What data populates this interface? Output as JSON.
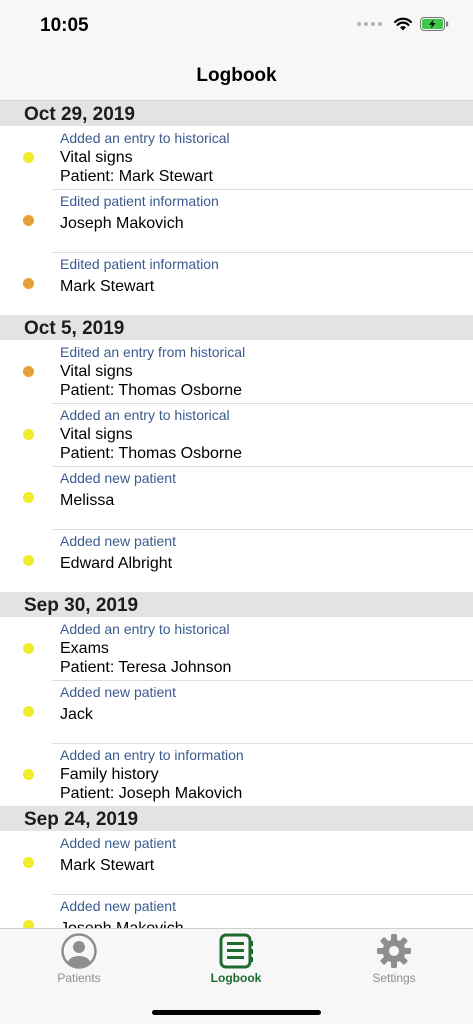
{
  "status_bar": {
    "time": "10:05"
  },
  "nav": {
    "title": "Logbook"
  },
  "colors": {
    "dot_added": "#f0ea2a",
    "dot_edited": "#e2a131",
    "active_tab": "#1f6b2f",
    "action_text": "#3b5b8f"
  },
  "sections": [
    {
      "date": "Oct 29, 2019",
      "entries": [
        {
          "dot": "added",
          "action": "Added an entry to historical",
          "line1": "Vital signs",
          "line2": "Patient: Mark Stewart"
        },
        {
          "dot": "edited",
          "action": "Edited patient information",
          "line1": "Joseph Makovich"
        },
        {
          "dot": "edited",
          "action": "Edited patient information",
          "line1": "Mark Stewart"
        }
      ]
    },
    {
      "date": "Oct 5, 2019",
      "entries": [
        {
          "dot": "edited",
          "action": "Edited an entry from historical",
          "line1": "Vital signs",
          "line2": "Patient: Thomas Osborne"
        },
        {
          "dot": "added",
          "action": "Added an entry to historical",
          "line1": "Vital signs",
          "line2": "Patient: Thomas Osborne"
        },
        {
          "dot": "added",
          "action": "Added new patient",
          "line1": "Melissa"
        },
        {
          "dot": "added",
          "action": "Added new patient",
          "line1": "Edward Albright"
        }
      ]
    },
    {
      "date": "Sep 30, 2019",
      "entries": [
        {
          "dot": "added",
          "action": "Added an entry to historical",
          "line1": "Exams",
          "line2": "Patient: Teresa Johnson"
        },
        {
          "dot": "added",
          "action": "Added new patient",
          "line1": "Jack"
        },
        {
          "dot": "added",
          "action": "Added an entry to information",
          "line1": "Family history",
          "line2": "Patient: Joseph Makovich"
        }
      ]
    },
    {
      "date": "Sep 24, 2019",
      "entries": [
        {
          "dot": "added",
          "action": "Added new patient",
          "line1": "Mark Stewart"
        },
        {
          "dot": "added",
          "action": "Added new patient",
          "line1": "Joseph Makovich"
        }
      ]
    }
  ],
  "tabs": [
    {
      "label": "Patients",
      "icon": "person-circle-icon",
      "active": false
    },
    {
      "label": "Logbook",
      "icon": "notebook-icon",
      "active": true
    },
    {
      "label": "Settings",
      "icon": "gear-icon",
      "active": false
    }
  ]
}
